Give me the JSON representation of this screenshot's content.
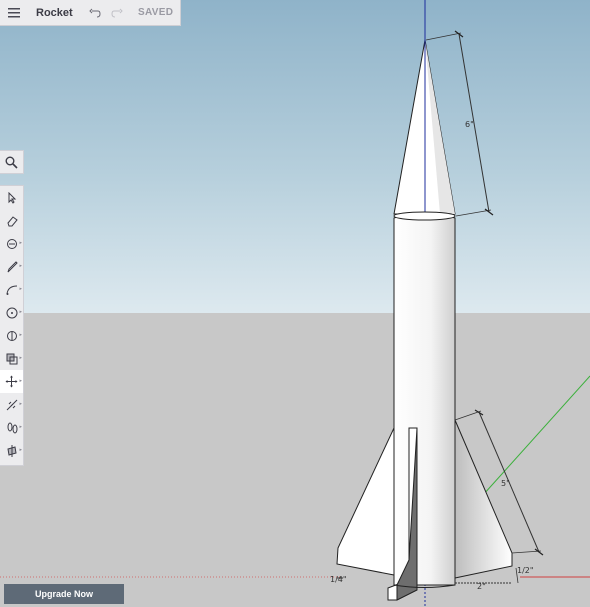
{
  "app": {
    "title": "Rocket",
    "save_status": "SAVED"
  },
  "toolbar": {
    "menu_icon": "hamburger-menu-icon",
    "undo_icon": "undo-icon",
    "redo_icon": "redo-icon"
  },
  "tools": [
    {
      "name": "select-tool",
      "icon": "arrow-icon"
    },
    {
      "name": "eraser-tool",
      "icon": "eraser-icon"
    },
    {
      "name": "paint-tool",
      "icon": "paint-bucket-icon"
    },
    {
      "name": "pencil-tool",
      "icon": "pencil-icon"
    },
    {
      "name": "arc-tool",
      "icon": "arc-icon"
    },
    {
      "name": "circle-tool",
      "icon": "circle-icon"
    },
    {
      "name": "push-pull-tool",
      "icon": "push-pull-icon"
    },
    {
      "name": "offset-tool",
      "icon": "offset-icon"
    },
    {
      "name": "move-tool",
      "icon": "move-icon"
    },
    {
      "name": "tape-measure-tool",
      "icon": "tape-measure-icon"
    },
    {
      "name": "walk-tool",
      "icon": "footprints-icon"
    },
    {
      "name": "section-tool",
      "icon": "section-plane-icon"
    }
  ],
  "active_tool": "move-tool",
  "model": {
    "dimensions": {
      "nose_length": "6\"",
      "fin_length": "5\"",
      "fin_width": "1/2\"",
      "fin_base": "2\"",
      "left_label": "1/4\""
    }
  },
  "upgrade_label": "Upgrade Now",
  "colors": {
    "sky_top": "#8fb3c9",
    "ground": "#c8c8c8",
    "blue_axis": "#1c2c9c",
    "red_axis": "#d04040",
    "green_axis": "#3bb03b"
  }
}
